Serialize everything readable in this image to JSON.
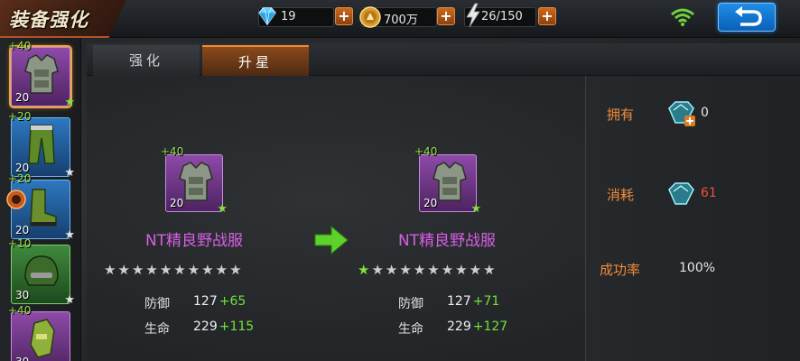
{
  "header": {
    "title": "装备强化"
  },
  "resources": {
    "diamond": {
      "value": "19",
      "icon": "diamond-icon"
    },
    "gold": {
      "value": "700万",
      "icon": "gold-coin-icon"
    },
    "energy": {
      "value": "26/150",
      "icon": "energy-bolt-icon"
    }
  },
  "tabs": [
    {
      "label": "强化",
      "active": false
    },
    {
      "label": "升星",
      "active": true
    }
  ],
  "equipment_list": [
    {
      "bonus": "+40",
      "level": "20",
      "rarity": "purple",
      "icon": "armor-vest-icon",
      "selected": true
    },
    {
      "bonus": "+20",
      "level": "20",
      "rarity": "blue",
      "icon": "pants-icon",
      "selected": false
    },
    {
      "bonus": "+20",
      "level": "20",
      "rarity": "blue",
      "icon": "boots-icon",
      "selected": false
    },
    {
      "bonus": "+10",
      "level": "30",
      "rarity": "green",
      "icon": "helmet-icon",
      "selected": false
    },
    {
      "bonus": "+40",
      "level": "30",
      "rarity": "purple",
      "icon": "gloves-icon",
      "selected": false
    }
  ],
  "current_item": {
    "bonus": "+40",
    "level": "20",
    "name": "NT精良野战服",
    "stars_filled": 0,
    "stars_total": 10,
    "stats": [
      {
        "label": "防御",
        "base": "127",
        "bonus": "+65"
      },
      {
        "label": "生命",
        "base": "229",
        "bonus": "+115"
      }
    ]
  },
  "next_item": {
    "bonus": "+40",
    "level": "20",
    "name": "NT精良野战服",
    "stars_filled": 1,
    "stars_total": 10,
    "stats": [
      {
        "label": "防御",
        "base": "127",
        "bonus": "+71"
      },
      {
        "label": "生命",
        "base": "229",
        "bonus": "+127"
      }
    ]
  },
  "requirements": {
    "owned": {
      "label": "拥有",
      "value": "0",
      "icon": "crystal-add-icon"
    },
    "cost": {
      "label": "消耗",
      "value": "61",
      "icon": "crystal-icon"
    },
    "success": {
      "label": "成功率",
      "value": "100%"
    }
  },
  "colors": {
    "accent": "#f08a3a",
    "bonus_green": "#6fe33a",
    "item_purple": "#d75ee6",
    "cost_red": "#f0503a"
  }
}
